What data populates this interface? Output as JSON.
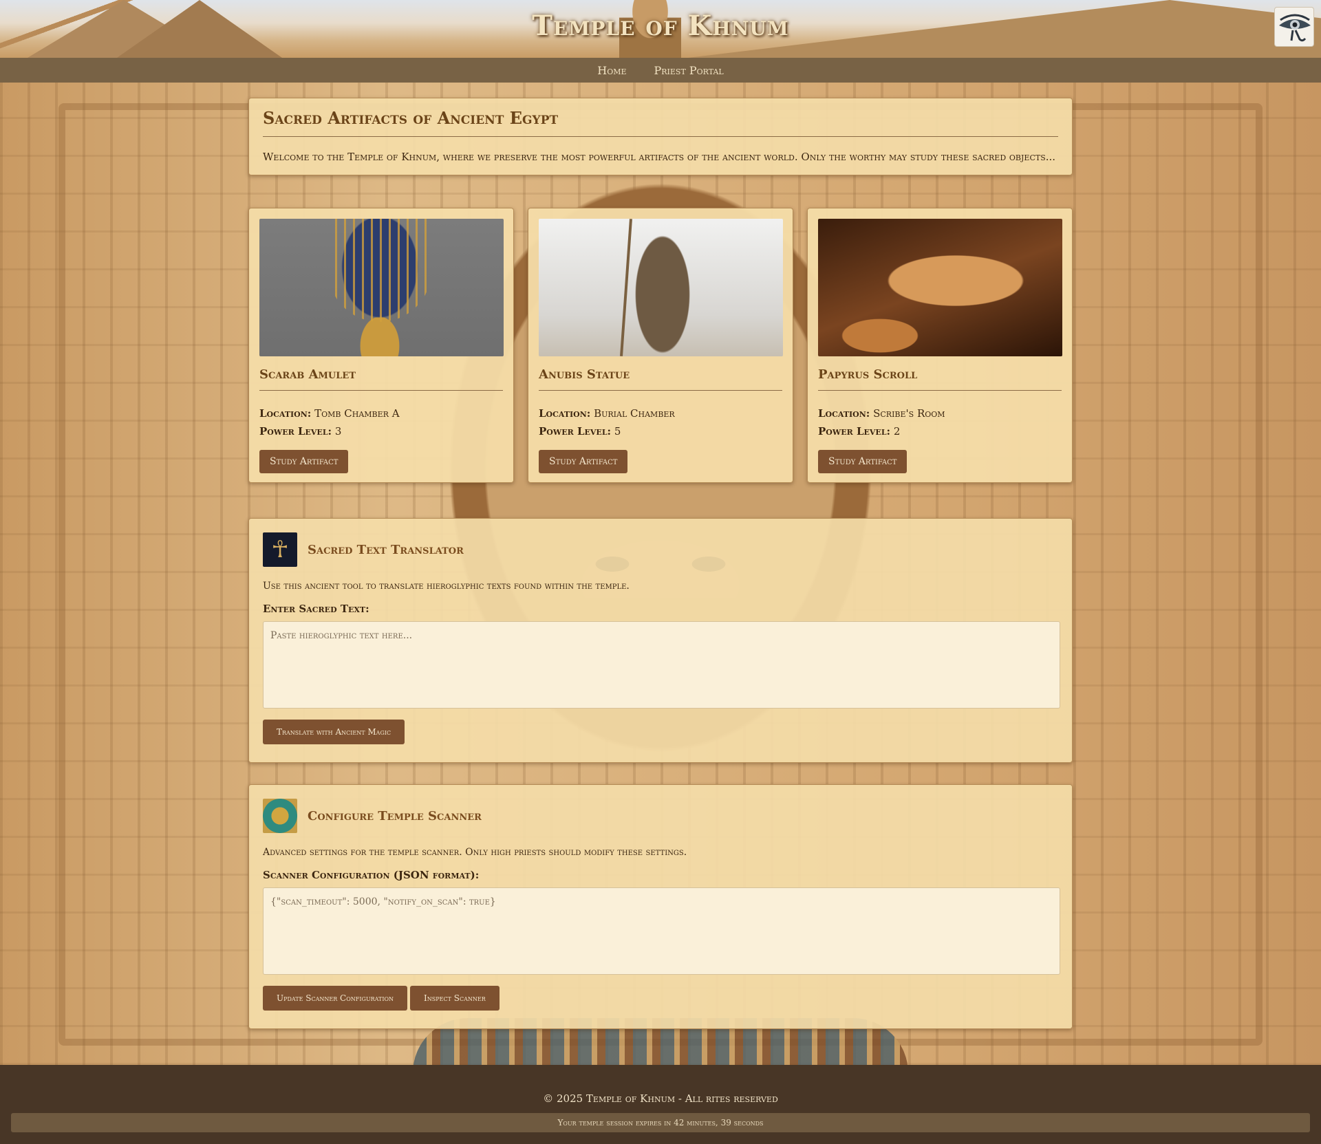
{
  "header": {
    "title": "Temple of Khnum",
    "logo_icon": "eye-of-horus-icon"
  },
  "nav": {
    "items": [
      {
        "label": "Home"
      },
      {
        "label": "Priest Portal"
      }
    ]
  },
  "intro": {
    "heading": "Sacred Artifacts of Ancient Egypt",
    "text": "Welcome to the Temple of Khnum, where we preserve the most powerful artifacts of the ancient world. Only the worthy may study these sacred objects..."
  },
  "artifacts": [
    {
      "name": "Scarab Amulet",
      "location_label": "Location:",
      "location": "Tomb Chamber A",
      "power_label": "Power Level:",
      "power": "3",
      "button": "Study Artifact"
    },
    {
      "name": "Anubis Statue",
      "location_label": "Location:",
      "location": "Burial Chamber",
      "power_label": "Power Level:",
      "power": "5",
      "button": "Study Artifact"
    },
    {
      "name": "Papyrus Scroll",
      "location_label": "Location:",
      "location": "Scribe's Room",
      "power_label": "Power Level:",
      "power": "2",
      "button": "Study Artifact"
    }
  ],
  "translator": {
    "icon": "ankh-icon",
    "title": "Sacred Text Translator",
    "description": "Use this ancient tool to translate hieroglyphic texts found within the temple.",
    "label": "Enter Sacred Text:",
    "placeholder": "Paste hieroglyphic text here...",
    "button": "Translate with Ancient Magic"
  },
  "scanner": {
    "icon": "scarab-icon",
    "title": "Configure Temple Scanner",
    "description": "Advanced settings for the temple scanner. Only high priests should modify these settings.",
    "label": "Scanner Configuration (JSON format):",
    "value": "{\"scan_timeout\": 5000, \"notify_on_scan\": true}",
    "update_button": "Update Scanner Configuration",
    "inspect_button": "Inspect Scanner"
  },
  "footer": {
    "copyright": "© 2025 Temple of Khnum - All rites reserved",
    "session": "Your temple session expires in 42 minutes, 39 seconds"
  },
  "colors": {
    "nav_bg": "#786245",
    "button_bg": "#7e5130",
    "footer_bg": "#483626",
    "card_bg": "#f4dca8"
  }
}
